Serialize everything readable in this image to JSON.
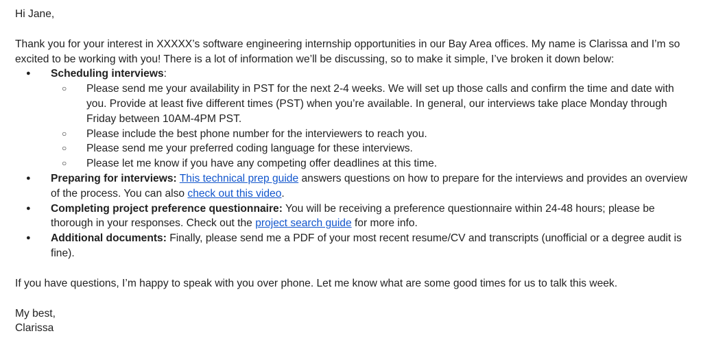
{
  "email": {
    "greeting": "Hi Jane,",
    "intro": "Thank you for your interest in XXXXX’s software engineering internship opportunities in our Bay Area offices. My name is Clarissa and I’m so excited to be working with you! There is a lot of information we’ll be discussing, so to make it simple, I’ve broken it down below:",
    "bullet_glyph": "●",
    "sub_bullet_glyph": "○",
    "scheduling": {
      "title": "Scheduling interviews",
      "colon": ":",
      "items": [
        "Please send me your availability in PST for the next 2-4 weeks. We will set up those calls and confirm the time and date with you. Provide at least five different times (PST) when you’re available. In general, our interviews take place Monday through Friday between 10AM-4PM PST.",
        "Please include the best phone number for the interviewers to reach you.",
        "Please send me your preferred coding language for these interviews.",
        "Please let me know if you have any competing offer deadlines at this time."
      ]
    },
    "preparing": {
      "title": "Preparing for interviews:",
      "link1": "This technical prep guide",
      "text1": " answers questions on how to prepare for the interviews and provides an overview of the process. You can also ",
      "link2": "check out this video",
      "text2": "."
    },
    "questionnaire": {
      "title": "Completing project preference questionnaire:",
      "text1": " You will be receiving a preference questionnaire within 24-48 hours; please be thorough in your responses. Check out the ",
      "link": "project search guide",
      "text2": " for more info."
    },
    "documents": {
      "title": "Additional documents:",
      "text": " Finally, please send me a PDF of your most recent resume/CV and transcripts (unofficial or a degree audit is fine)."
    },
    "closing_question": "If you have questions, I’m happy to speak with you over phone. Let me know what are some good times for us to talk this week.",
    "signoff": "My best,",
    "signature": "Clarissa"
  }
}
